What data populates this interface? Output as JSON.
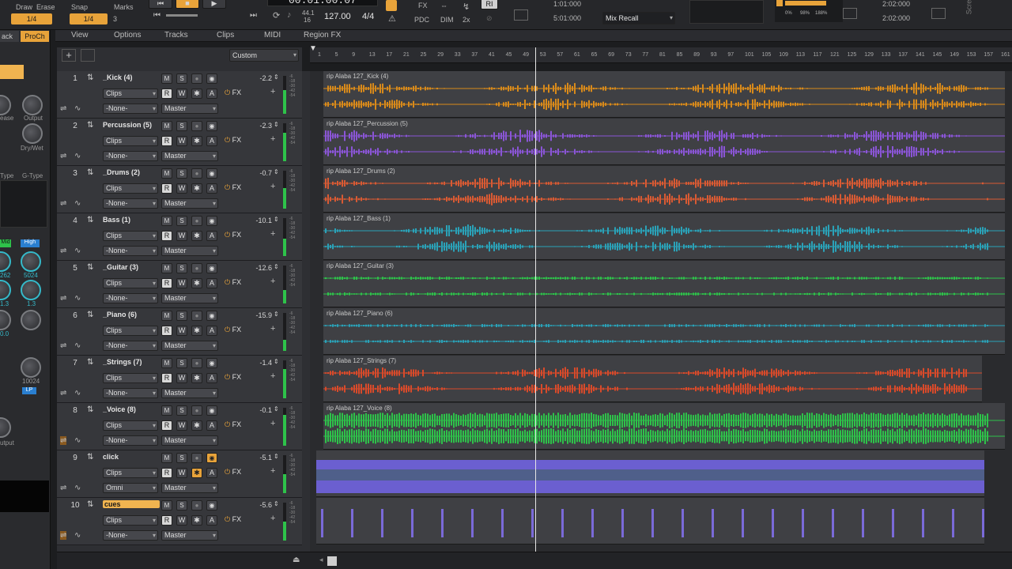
{
  "transport": {
    "snap_label": "Snap",
    "marks_label": "Marks",
    "draw_label": "Draw",
    "erase_label": "Erase",
    "snap_value": "1/4",
    "snap_value2": "1/4",
    "marks_value": "3",
    "time_display": "00:01:00:07",
    "sample_rate": "44.1",
    "bit_depth": "16",
    "tempo": "127.00",
    "meter": "4/4",
    "fx_label": "FX",
    "pdc_label": "PDC",
    "x2_label": "2x",
    "ri_label": "RI",
    "loop_start": "1:01:000",
    "loop_end": "5:01:000",
    "mix_recall": "Mix Recall",
    "time_a": "2:02:000",
    "time_b": "2:02:000",
    "cpu_a": "0%",
    "cpu_b": "98%",
    "cpu_c": "188%",
    "screen_label": "Scre"
  },
  "menubar": {
    "view": "View",
    "options": "Options",
    "tracks": "Tracks",
    "clips": "Clips",
    "midi": "MIDI",
    "region_fx": "Region FX"
  },
  "inspector": {
    "tab_track": "ack",
    "tab_proch": "ProCh",
    "release": "ease",
    "output": "Output",
    "drywet": "Dry/Wet",
    "type_label": "Type",
    "gtype_label": "G-Type",
    "mid": "Mid",
    "high": "High",
    "val_262": "262",
    "val_5024": "5024",
    "val_13a": "1.3",
    "val_13b": "1.3",
    "val_00": "0.0",
    "val_10024": "10024",
    "lp": "LP",
    "output2": "utput"
  },
  "track_header": {
    "preset": "Custom"
  },
  "ruler": {
    "labels": [
      "1",
      "5",
      "9",
      "13",
      "17",
      "21",
      "25",
      "29",
      "33",
      "37",
      "41",
      "45",
      "49",
      "53",
      "57",
      "61",
      "65",
      "69",
      "73",
      "77",
      "81",
      "85",
      "89",
      "93",
      "97",
      "101",
      "105",
      "109",
      "113",
      "117",
      "121",
      "125",
      "129",
      "133",
      "137",
      "141",
      "145",
      "149",
      "153",
      "157",
      "161"
    ]
  },
  "tracks": [
    {
      "num": "1",
      "name": "_Kick (4)",
      "volume": "-2.2",
      "input": "Clips",
      "route": "-None-",
      "out": "Master",
      "clip": "rip Alaba 127_Kick (4)",
      "color": "#d98a1a",
      "meter": 0.62
    },
    {
      "num": "2",
      "name": "Percussion (5)",
      "volume": "-2.3",
      "input": "Clips",
      "route": "-None-",
      "out": "Master",
      "clip": "rip Alaba 127_Percussion (5)",
      "color": "#8a55d6",
      "meter": 0.75
    },
    {
      "num": "3",
      "name": "_Drums (2)",
      "volume": "-0.7",
      "input": "Clips",
      "route": "-None-",
      "out": "Master",
      "clip": "rip Alaba 127_Drums (2)",
      "color": "#d95a33",
      "meter": 0.55
    },
    {
      "num": "4",
      "name": "Bass (1)",
      "volume": "-10.1",
      "input": "Clips",
      "route": "-None-",
      "out": "Master",
      "clip": "rip Alaba 127_Bass (1)",
      "color": "#2aa2b8",
      "meter": 0.45
    },
    {
      "num": "5",
      "name": "_Guitar (3)",
      "volume": "-12.6",
      "input": "Clips",
      "route": "-None-",
      "out": "Master",
      "clip": "rip Alaba 127_Guitar (3)",
      "color": "#2ec24a",
      "meter": 0.35
    },
    {
      "num": "6",
      "name": "_Piano (6)",
      "volume": "-15.9",
      "input": "Clips",
      "route": "-None-",
      "out": "Master",
      "clip": "rip Alaba 127_Piano (6)",
      "color": "#2aa2b8",
      "meter": 0.3
    },
    {
      "num": "7",
      "name": "_Strings (7)",
      "volume": "-1.4",
      "input": "Clips",
      "route": "-None-",
      "out": "Master",
      "clip": "rip Alaba 127_Strings (7)",
      "color": "#d94a2a",
      "meter": 0.78
    },
    {
      "num": "8",
      "name": "_Voice (8)",
      "volume": "-0.1",
      "input": "Clips",
      "route": "-None-",
      "out": "Master",
      "clip": "rip Alaba 127_Voice (8)",
      "color": "#2ec24a",
      "meter": 0.82
    },
    {
      "num": "9",
      "name": "click",
      "volume": "-5.1",
      "input": "Clips",
      "route": "Omni",
      "out": "Master",
      "clip": "",
      "color": "#6b5fd0",
      "meter": 0.5
    },
    {
      "num": "10",
      "name": "cues",
      "volume": "-5.6",
      "input": "Clips",
      "route": "-None-",
      "out": "Master",
      "clip": "",
      "color": "#7a6ad8",
      "meter": 0.5
    }
  ],
  "labels": {
    "m": "M",
    "s": "S",
    "r": "R",
    "w": "W",
    "a": "A",
    "fx": "FX",
    "rip_small": "rip"
  },
  "playhead_fraction": 0.323
}
